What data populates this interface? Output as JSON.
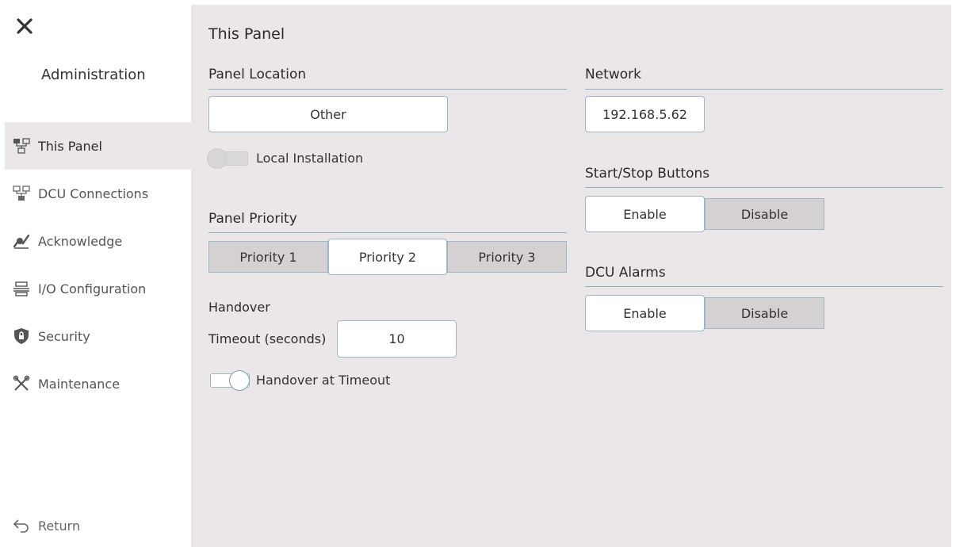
{
  "sidebar": {
    "title": "Administration",
    "items": [
      {
        "label": "This Panel",
        "icon": "panel-icon",
        "active": true
      },
      {
        "label": "DCU Connections",
        "icon": "network-icon",
        "active": false
      },
      {
        "label": "Acknowledge",
        "icon": "acknowledge-icon",
        "active": false
      },
      {
        "label": "I/O Configuration",
        "icon": "io-icon",
        "active": false
      },
      {
        "label": "Security",
        "icon": "shield-icon",
        "active": false
      },
      {
        "label": "Maintenance",
        "icon": "tools-icon",
        "active": false
      }
    ],
    "return_label": "Return"
  },
  "main": {
    "title": "This Panel",
    "panel_location": {
      "label": "Panel Location",
      "value": "Other",
      "local_installation": {
        "label": "Local Installation",
        "on": false
      }
    },
    "panel_priority": {
      "label": "Panel Priority",
      "options": [
        "Priority 1",
        "Priority 2",
        "Priority 3"
      ],
      "selected": "Priority 2"
    },
    "handover": {
      "label": "Handover",
      "timeout_label": "Timeout (seconds)",
      "timeout_value": "10",
      "at_timeout": {
        "label": "Handover at Timeout",
        "on": true
      }
    },
    "network": {
      "label": "Network",
      "ip": "192.168.5.62"
    },
    "start_stop": {
      "label": "Start/Stop Buttons",
      "options": [
        "Enable",
        "Disable"
      ],
      "selected": "Enable"
    },
    "dcu_alarms": {
      "label": "DCU Alarms",
      "options": [
        "Enable",
        "Disable"
      ],
      "selected": "Enable"
    }
  },
  "colors": {
    "main_bg": "#ebe7e9",
    "accent_line": "#8fb1c6",
    "segment_off": "#d5d1d3"
  }
}
